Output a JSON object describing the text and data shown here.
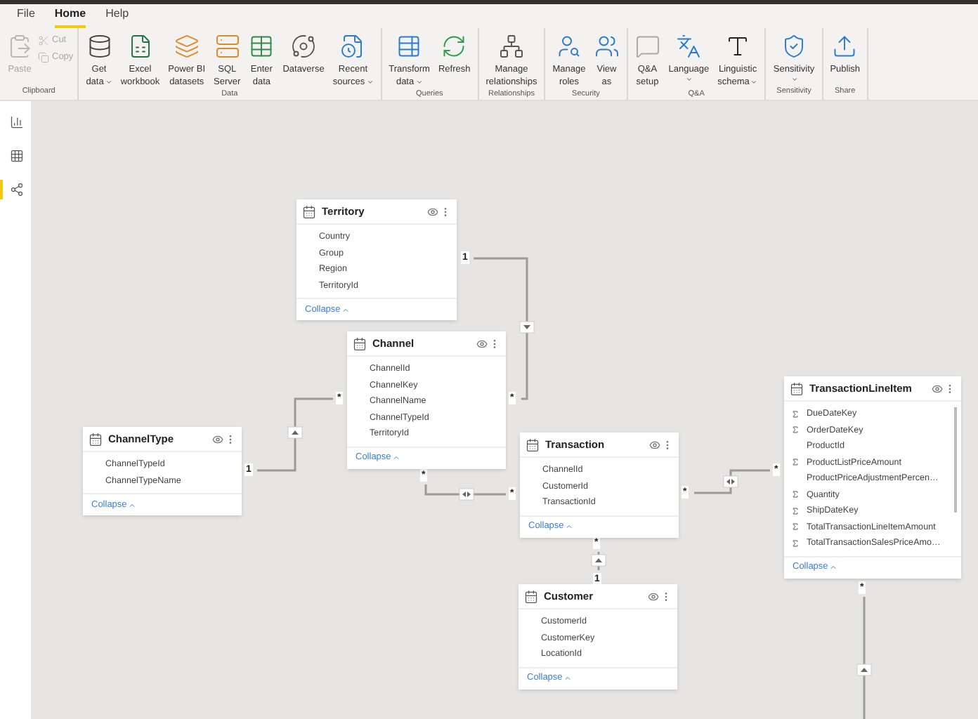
{
  "tabs": [
    {
      "label": "File",
      "selected": false
    },
    {
      "label": "Home",
      "selected": true
    },
    {
      "label": "Help",
      "selected": false
    }
  ],
  "ribbon": [
    {
      "label": "Clipboard",
      "buttons": [
        {
          "kind": "paste",
          "lines": [
            "Paste"
          ],
          "disabled": true,
          "dropdown": false
        },
        {
          "kind": "cut",
          "lines": [
            "Cut"
          ],
          "disabled": true,
          "dropdown": false
        },
        {
          "kind": "copy",
          "lines": [
            "Copy"
          ],
          "disabled": true,
          "dropdown": false
        }
      ]
    },
    {
      "label": "Data",
      "buttons": [
        {
          "kind": "database",
          "lines": [
            "Get",
            "data"
          ],
          "disabled": false,
          "dropdown": true
        },
        {
          "kind": "excel",
          "lines": [
            "Excel",
            "workbook"
          ],
          "disabled": false,
          "dropdown": false
        },
        {
          "kind": "datasets",
          "lines": [
            "Power BI",
            "datasets"
          ],
          "disabled": false,
          "dropdown": false
        },
        {
          "kind": "server",
          "lines": [
            "SQL",
            "Server"
          ],
          "disabled": false,
          "dropdown": false
        },
        {
          "kind": "table",
          "lines": [
            "Enter",
            "data"
          ],
          "disabled": false,
          "dropdown": false
        },
        {
          "kind": "orbit",
          "lines": [
            "Dataverse"
          ],
          "disabled": false,
          "dropdown": false
        },
        {
          "kind": "recent",
          "lines": [
            "Recent",
            "sources"
          ],
          "disabled": false,
          "dropdown": true
        }
      ]
    },
    {
      "label": "Queries",
      "buttons": [
        {
          "kind": "transform",
          "lines": [
            "Transform",
            "data"
          ],
          "disabled": false,
          "dropdown": true
        },
        {
          "kind": "refresh",
          "lines": [
            "Refresh"
          ],
          "disabled": false,
          "dropdown": false
        }
      ]
    },
    {
      "label": "Relationships",
      "buttons": [
        {
          "kind": "network",
          "lines": [
            "Manage",
            "relationships"
          ],
          "disabled": false,
          "dropdown": false
        }
      ]
    },
    {
      "label": "Security",
      "buttons": [
        {
          "kind": "user-search",
          "lines": [
            "Manage",
            "roles"
          ],
          "disabled": false,
          "dropdown": false
        },
        {
          "kind": "users",
          "lines": [
            "View",
            "as"
          ],
          "disabled": false,
          "dropdown": false
        }
      ]
    },
    {
      "label": "Q&A",
      "buttons": [
        {
          "kind": "chat",
          "lines": [
            "Q&A",
            "setup"
          ],
          "disabled": false,
          "dropdown": false
        },
        {
          "kind": "language",
          "lines": [
            "Language"
          ],
          "disabled": false,
          "dropdown": true
        },
        {
          "kind": "letter",
          "lines": [
            "Linguistic",
            "schema"
          ],
          "disabled": false,
          "dropdown": true
        }
      ]
    },
    {
      "label": "Sensitivity",
      "buttons": [
        {
          "kind": "shield",
          "lines": [
            "Sensitivity"
          ],
          "disabled": false,
          "dropdown": true
        }
      ]
    },
    {
      "label": "Share",
      "buttons": [
        {
          "kind": "upload",
          "lines": [
            "Publish"
          ],
          "disabled": false,
          "dropdown": false
        }
      ]
    }
  ],
  "views": [
    {
      "kind": "report",
      "selected": false
    },
    {
      "kind": "data",
      "selected": false
    },
    {
      "kind": "model",
      "selected": true
    }
  ],
  "tables": [
    {
      "name": "Territory",
      "collapse": "Collapse",
      "scrollbar": false,
      "fields": [
        {
          "name": "Country",
          "sum": false
        },
        {
          "name": "Group",
          "sum": false
        },
        {
          "name": "Region",
          "sum": false
        },
        {
          "name": "TerritoryId",
          "sum": false
        }
      ]
    },
    {
      "name": "Channel",
      "collapse": "Collapse",
      "scrollbar": false,
      "fields": [
        {
          "name": "ChannelId",
          "sum": false
        },
        {
          "name": "ChannelKey",
          "sum": false
        },
        {
          "name": "ChannelName",
          "sum": false
        },
        {
          "name": "ChannelTypeId",
          "sum": false
        },
        {
          "name": "TerritoryId",
          "sum": false
        }
      ]
    },
    {
      "name": "ChannelType",
      "collapse": "Collapse",
      "scrollbar": false,
      "fields": [
        {
          "name": "ChannelTypeId",
          "sum": false
        },
        {
          "name": "ChannelTypeName",
          "sum": false
        }
      ]
    },
    {
      "name": "Transaction",
      "collapse": "Collapse",
      "scrollbar": false,
      "fields": [
        {
          "name": "ChannelId",
          "sum": false
        },
        {
          "name": "CustomerId",
          "sum": false
        },
        {
          "name": "TransactionId",
          "sum": false
        }
      ]
    },
    {
      "name": "Customer",
      "collapse": "Collapse",
      "scrollbar": false,
      "fields": [
        {
          "name": "CustomerId",
          "sum": false
        },
        {
          "name": "CustomerKey",
          "sum": false
        },
        {
          "name": "LocationId",
          "sum": false
        }
      ]
    },
    {
      "name": "TransactionLineItem",
      "collapse": "Collapse",
      "scrollbar": true,
      "fields": [
        {
          "name": "DueDateKey",
          "sum": true
        },
        {
          "name": "OrderDateKey",
          "sum": true
        },
        {
          "name": "ProductId",
          "sum": false
        },
        {
          "name": "ProductListPriceAmount",
          "sum": true
        },
        {
          "name": "ProductPriceAdjustmentPercen…",
          "sum": false
        },
        {
          "name": "Quantity",
          "sum": true
        },
        {
          "name": "ShipDateKey",
          "sum": true
        },
        {
          "name": "TotalTransactionLineItemAmount",
          "sum": true
        },
        {
          "name": "TotalTransactionSalesPriceAmo…",
          "sum": true
        }
      ]
    }
  ],
  "relationships": [
    {
      "one_end": "1",
      "many_end": "*",
      "bidirectional": false
    },
    {
      "one_end": "1",
      "many_end": "*",
      "bidirectional": false
    },
    {
      "one_end": "*",
      "many_end": "*",
      "bidirectional": true
    },
    {
      "one_end": "*",
      "many_end": "*",
      "bidirectional": true
    },
    {
      "one_end": "1",
      "many_end": "*",
      "bidirectional": false
    },
    {
      "many_end": "*",
      "bidirectional": false
    }
  ]
}
